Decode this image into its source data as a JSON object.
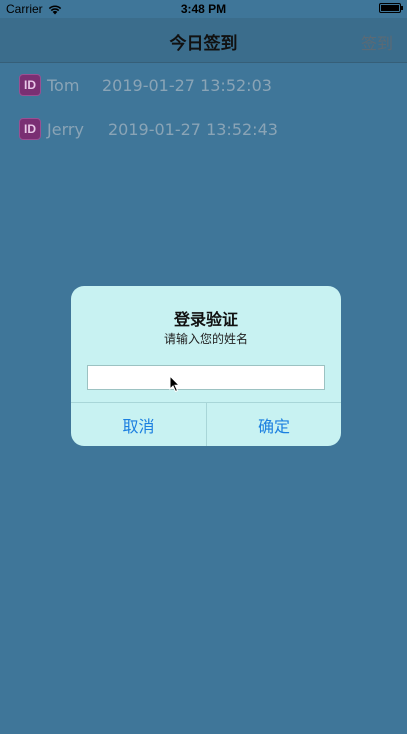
{
  "status_bar": {
    "carrier": "Carrier",
    "time": "3:48 PM"
  },
  "nav": {
    "title": "今日签到",
    "right_button": "签到"
  },
  "list": {
    "items": [
      {
        "icon": "ID",
        "name": "Tom",
        "time": "2019-01-27  13:52:03"
      },
      {
        "icon": "ID",
        "name": "Jerry",
        "time": "2019-01-27  13:52:43"
      }
    ]
  },
  "dialog": {
    "title": "登录验证",
    "message": "请输入您的姓名",
    "input_value": "",
    "input_placeholder": "",
    "cancel_label": "取消",
    "ok_label": "确定"
  },
  "colors": {
    "background_dim": "#3f7699",
    "dialog_bg": "#c8f2f2",
    "button_blue": "#1b7fe0",
    "id_icon_purple": "#7a2f73"
  },
  "icons": {
    "wifi": "wifi-icon",
    "battery": "battery-icon",
    "id": "id-badge-icon",
    "cursor": "mouse-pointer-icon"
  }
}
